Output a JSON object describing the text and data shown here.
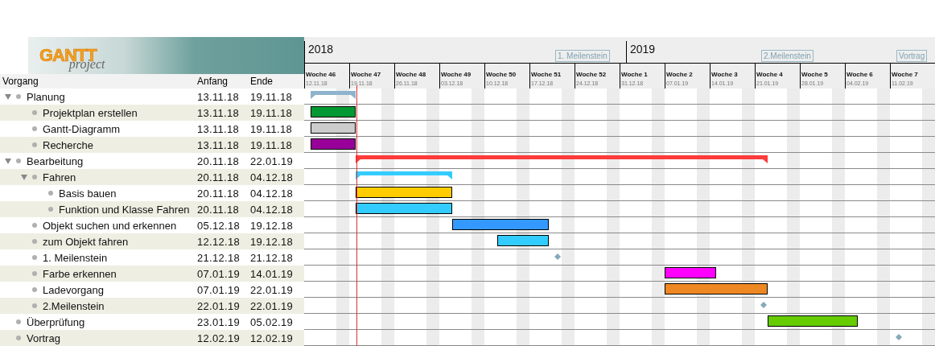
{
  "logo": {
    "title": "GANTT",
    "subtitle": "project"
  },
  "columns": [
    "Vorgang",
    "Anfang",
    "Ende"
  ],
  "timeline": {
    "years": [
      "2018",
      "2019"
    ],
    "weeks": [
      {
        "label": "Woche 46",
        "date": "12.11.18"
      },
      {
        "label": "Woche 47",
        "date": "19.11.18"
      },
      {
        "label": "Woche 48",
        "date": "26.11.18"
      },
      {
        "label": "Woche 49",
        "date": "03.12.18"
      },
      {
        "label": "Woche 50",
        "date": "10.12.18"
      },
      {
        "label": "Woche 51",
        "date": "17.12.18"
      },
      {
        "label": "Woche 52",
        "date": "24.12.18"
      },
      {
        "label": "Woche 1",
        "date": "31.12.18"
      },
      {
        "label": "Woche 2",
        "date": "07.01.19"
      },
      {
        "label": "Woche 3",
        "date": "14.01.19"
      },
      {
        "label": "Woche 4",
        "date": "21.01.19"
      },
      {
        "label": "Woche 5",
        "date": "28.01.19"
      },
      {
        "label": "Woche 6",
        "date": "04.02.19"
      },
      {
        "label": "Woche 7",
        "date": "11.02.19"
      }
    ],
    "milestone_labels": [
      "1. Meilenstein",
      "2.Meilenstein",
      "Vortrag"
    ]
  },
  "tasks": [
    {
      "name": "Planung",
      "start": "13.11.18",
      "end": "19.11.18",
      "kind": "summary",
      "expanded": true,
      "color": "#8fb3cc",
      "children": [
        {
          "name": "Projektplan erstellen",
          "start": "13.11.18",
          "end": "19.11.18",
          "kind": "task",
          "color": "#009933"
        },
        {
          "name": "Gantt-Diagramm",
          "start": "13.11.18",
          "end": "19.11.18",
          "kind": "task",
          "color": "#cccccc"
        },
        {
          "name": "Recherche",
          "start": "13.11.18",
          "end": "19.11.18",
          "kind": "task",
          "color": "#990099"
        }
      ]
    },
    {
      "name": "Bearbeitung",
      "start": "20.11.18",
      "end": "22.01.19",
      "kind": "summary",
      "expanded": true,
      "color": "#ff3b3b",
      "children": [
        {
          "name": "Fahren",
          "start": "20.11.18",
          "end": "04.12.18",
          "kind": "summary",
          "expanded": true,
          "color": "#33ccff",
          "children": [
            {
              "name": "Basis bauen",
              "start": "20.11.18",
              "end": "04.12.18",
              "kind": "task",
              "color": "#ffcc00"
            },
            {
              "name": "Funktion und Klasse Fahren",
              "start": "20.11.18",
              "end": "04.12.18",
              "kind": "task",
              "color": "#33ccff"
            }
          ]
        },
        {
          "name": "Objekt suchen und erkennen",
          "start": "05.12.18",
          "end": "19.12.18",
          "kind": "task",
          "color": "#3399ff"
        },
        {
          "name": "zum Objekt fahren",
          "start": "12.12.18",
          "end": "19.12.18",
          "kind": "task",
          "color": "#33ccff"
        },
        {
          "name": "1. Meilenstein",
          "start": "21.12.18",
          "end": "21.12.18",
          "kind": "milestone"
        },
        {
          "name": "Farbe erkennen",
          "start": "07.01.19",
          "end": "14.01.19",
          "kind": "task",
          "color": "#ff00ff"
        },
        {
          "name": "Ladevorgang",
          "start": "07.01.19",
          "end": "22.01.19",
          "kind": "task",
          "color": "#ee8822"
        },
        {
          "name": "2.Meilenstein",
          "start": "22.01.19",
          "end": "22.01.19",
          "kind": "milestone"
        }
      ]
    },
    {
      "name": "Überprüfung",
      "start": "23.01.19",
      "end": "05.02.19",
      "kind": "task",
      "color": "#66cc00"
    },
    {
      "name": "Vortrag",
      "start": "12.02.19",
      "end": "12.02.19",
      "kind": "milestone"
    }
  ]
}
